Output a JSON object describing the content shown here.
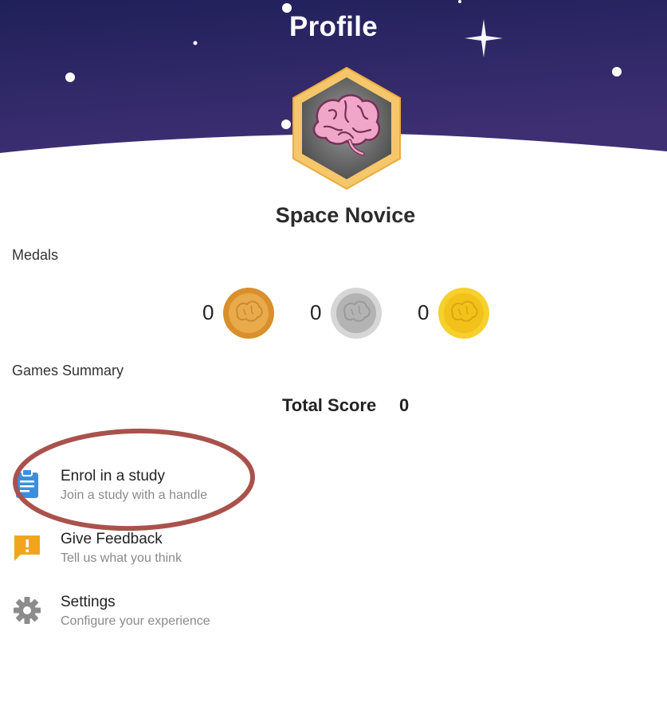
{
  "header": {
    "title": "Profile"
  },
  "profile": {
    "rank_title": "Space Novice"
  },
  "medals": {
    "label": "Medals",
    "items": [
      {
        "kind": "bronze",
        "count": "0",
        "color": "#e0a23a"
      },
      {
        "kind": "silver",
        "count": "0",
        "color": "#bdbdbd"
      },
      {
        "kind": "gold",
        "count": "0",
        "color": "#f2c21a"
      }
    ]
  },
  "games_summary": {
    "label": "Games Summary",
    "total_score_label": "Total Score",
    "total_score_value": "0"
  },
  "menu": [
    {
      "title": "Enrol in a study",
      "subtitle": "Join a study with a handle",
      "icon": "clipboard-icon",
      "color": "#3b8fe0"
    },
    {
      "title": "Give Feedback",
      "subtitle": "Tell us what you think",
      "icon": "feedback-icon",
      "color": "#f2a51c"
    },
    {
      "title": "Settings",
      "subtitle": "Configure your experience",
      "icon": "gear-icon",
      "color": "#8c8c8c"
    }
  ],
  "colors": {
    "header_top": "#22215a",
    "header_bottom": "#3b2d6e",
    "annotation_ring": "#a9524c",
    "badge_gold": "#f3c060"
  }
}
